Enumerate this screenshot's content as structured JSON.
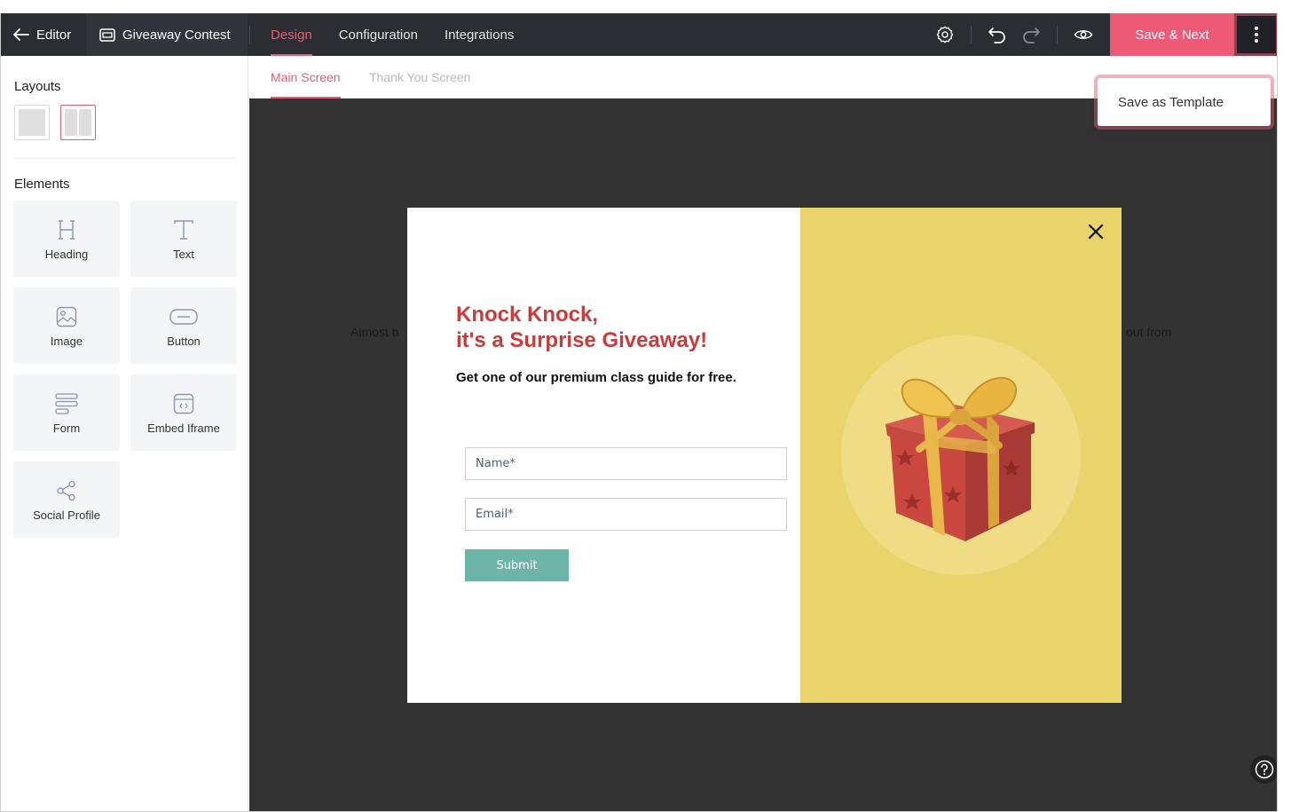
{
  "topbar": {
    "back_label": "Editor",
    "project_name": "Giveaway Contest",
    "tabs": [
      {
        "label": "Design"
      },
      {
        "label": "Configuration"
      },
      {
        "label": "Integrations"
      }
    ],
    "save_label": "Save & Next",
    "icons": [
      "settings-icon",
      "undo-icon",
      "redo-icon",
      "preview-icon",
      "more-icon"
    ]
  },
  "sidebar": {
    "layouts_title": "Layouts",
    "elements_title": "Elements",
    "elements": [
      {
        "label": "Heading",
        "icon": "heading-icon"
      },
      {
        "label": "Text",
        "icon": "text-icon"
      },
      {
        "label": "Image",
        "icon": "image-icon"
      },
      {
        "label": "Button",
        "icon": "button-icon"
      },
      {
        "label": "Form",
        "icon": "form-icon"
      },
      {
        "label": "Embed Iframe",
        "icon": "embed-icon"
      },
      {
        "label": "Social Profile",
        "icon": "share-icon"
      }
    ]
  },
  "subtabs": [
    {
      "label": "Main Screen"
    },
    {
      "label": "Thank You Screen"
    }
  ],
  "canvas": {
    "bg_text_left": "Almost b",
    "bg_text_right": "out from"
  },
  "popup": {
    "headline_line1": "Knock Knock,",
    "headline_line2": "it's a Surprise Giveaway!",
    "subline": "Get one of our premium class guide for free.",
    "name_placeholder": "Name*",
    "email_placeholder": "Email*",
    "submit_label": "Submit"
  },
  "menu": {
    "save_template": "Save as Template"
  },
  "colors": {
    "accent": "#ee5a75",
    "topbar": "#2b2d33",
    "canvas": "#333333",
    "popup_right": "#e9d36b",
    "headline": "#cc3a3a",
    "submit": "#6db5a6"
  }
}
